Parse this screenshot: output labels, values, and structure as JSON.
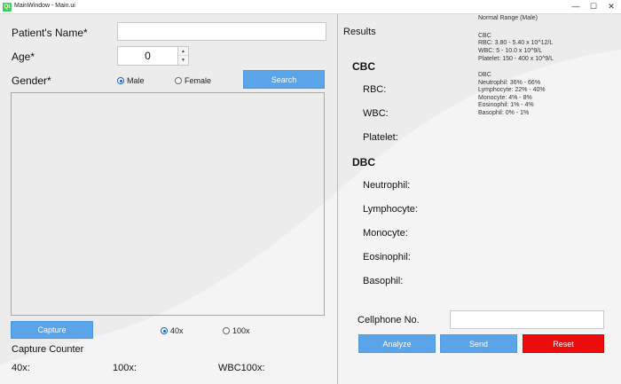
{
  "window": {
    "title": "MainWindow - Main.ui",
    "icon": "Qt",
    "minimize_icon": "minimize-icon",
    "maximize_icon": "maximize-icon",
    "close_icon": "close-icon",
    "minimize_glyph": "—",
    "maximize_glyph": "☐",
    "close_glyph": "✕"
  },
  "patient": {
    "name_label": "Patient's Name*",
    "name_value": "",
    "age_label": "Age*",
    "age_value": "0",
    "age_up": "▲",
    "age_down": "▼",
    "gender_label": "Gender*",
    "gender_options": [
      "Male",
      "Female"
    ],
    "gender_selected": "Male",
    "search_label": "Search"
  },
  "capture": {
    "button_label": "Capture",
    "magnification_options": [
      "40x",
      "100x"
    ],
    "magnification_selected": "40x",
    "counter_title": "Capture Counter",
    "counter_40x": "40x:",
    "counter_100x": "100x:",
    "counter_wbc100x": "WBC100x:"
  },
  "results": {
    "title": "Results",
    "cbc_header": "CBC",
    "rbc_label": "RBC:",
    "wbc_label": "WBC:",
    "platelet_label": "Platelet:",
    "dbc_header": "DBC",
    "neutrophil_label": "Neutrophil:",
    "lymphocyte_label": "Lymphocyte:",
    "monocyte_label": "Monocyte:",
    "eosinophil_label": "Eosinophil:",
    "basophil_label": "Basophil:"
  },
  "normal_range": {
    "title": "Normal Range (Male)",
    "cbc_title": "CBC",
    "cbc_lines": [
      "RBC: 3.80 - 5.40 x 10^12/L",
      "WBC: 5 - 10.0 x 10^9/L",
      "Platelet: 150 - 400 x 10^9/L"
    ],
    "dbc_title": "DBC",
    "dbc_lines": [
      "Neutrophil: 36% - 66%",
      "Lymphocyte: 22% - 40%",
      "Monocyte: 4% - 8%",
      "Eosinophil: 1% - 4%",
      "Basophil: 0% - 1%"
    ]
  },
  "contact": {
    "cellphone_label": "Cellphone No.",
    "cellphone_value": ""
  },
  "actions": {
    "analyze_label": "Analyze",
    "send_label": "Send",
    "reset_label": "Reset"
  },
  "colors": {
    "button_blue": "#5aa4ea",
    "reset_red": "#ec0c0c",
    "radio_blue": "#1560c5"
  }
}
